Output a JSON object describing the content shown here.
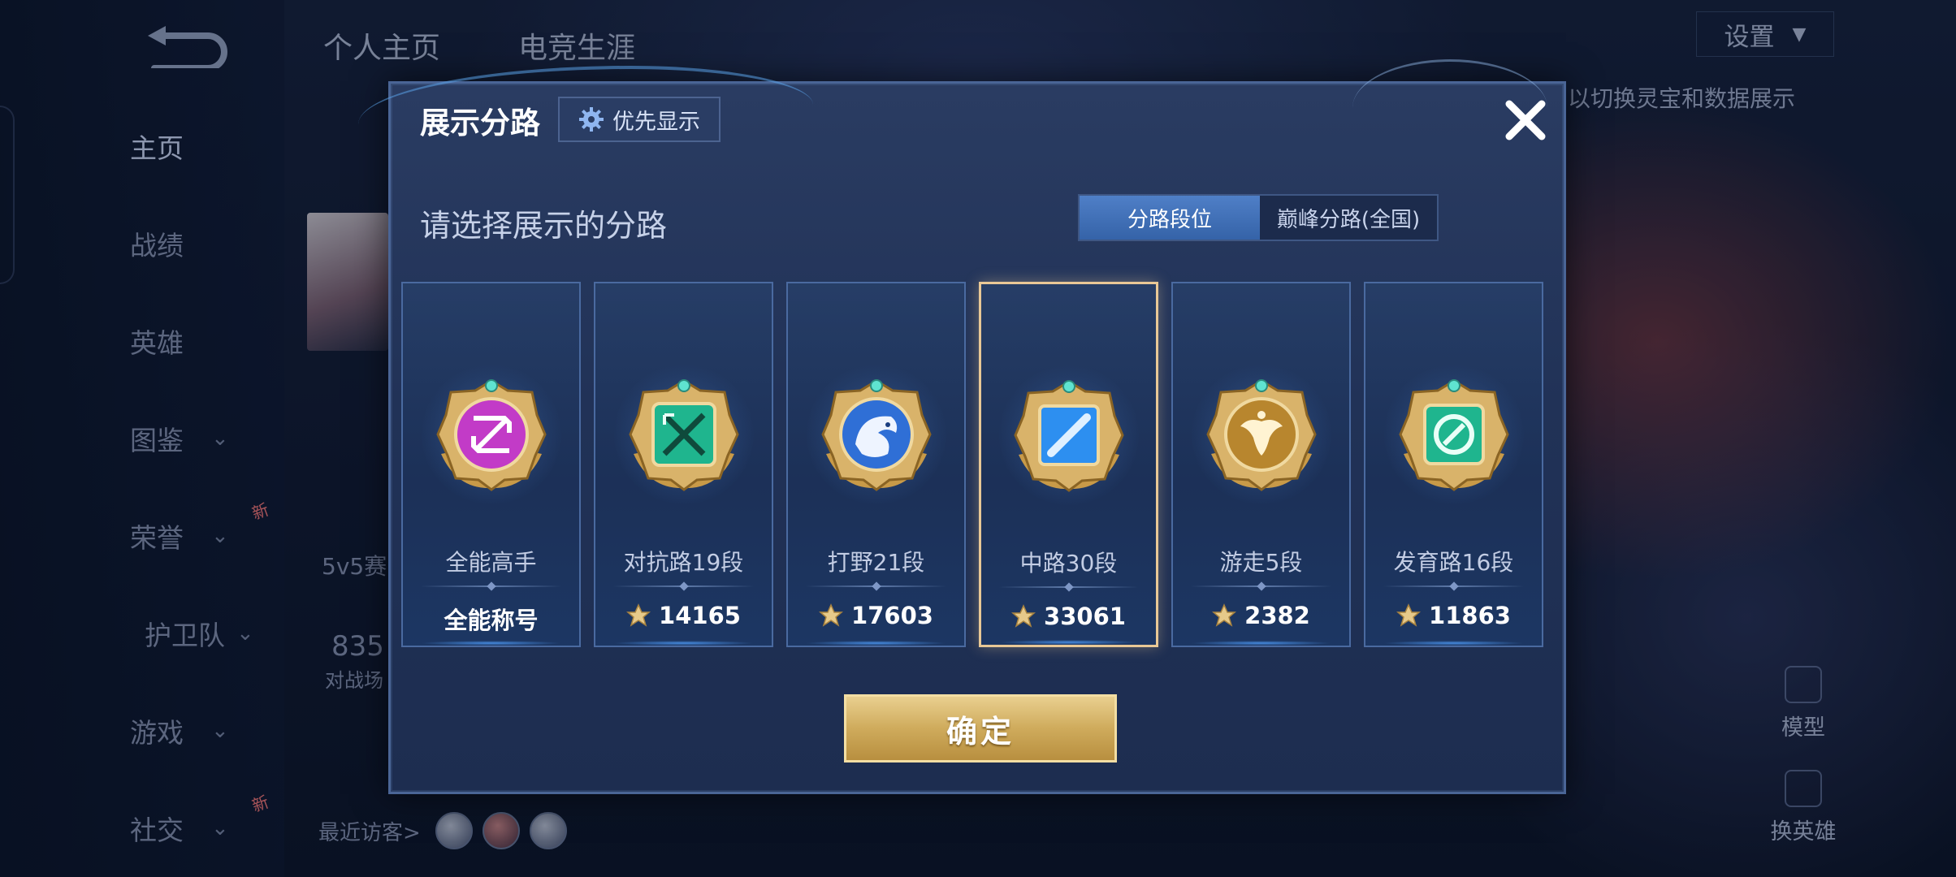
{
  "background": {
    "top_tabs": [
      "个人主页",
      "电竞生涯"
    ],
    "nav_items": [
      {
        "label": "主页",
        "active": true,
        "chevron": false,
        "badge": ""
      },
      {
        "label": "战绩",
        "active": false,
        "chevron": false,
        "badge": ""
      },
      {
        "label": "英雄",
        "active": false,
        "chevron": false,
        "badge": ""
      },
      {
        "label": "图鉴",
        "active": false,
        "chevron": true,
        "badge": ""
      },
      {
        "label": "荣誉",
        "active": false,
        "chevron": true,
        "badge": "新"
      },
      {
        "label": "护卫队",
        "active": false,
        "chevron": true,
        "badge": ""
      },
      {
        "label": "游戏",
        "active": false,
        "chevron": true,
        "badge": ""
      },
      {
        "label": "社交",
        "active": false,
        "chevron": true,
        "badge": "新"
      }
    ],
    "settings_label": "设置",
    "hint": "以切换灵宝和数据展示",
    "right_controls": [
      "模型",
      "换英雄"
    ],
    "recent_visitors": "最近访客>",
    "fragments": [
      "5v5赛",
      "835",
      "对战场"
    ]
  },
  "modal": {
    "title": "展示分路",
    "priority_button": "优先显示",
    "subtitle": "请选择展示的分路",
    "toggle": {
      "active": "分路段位",
      "inactive": "巅峰分路(全国)"
    },
    "cards": [
      {
        "name": "全能高手",
        "value": "全能称号",
        "show_icon": false,
        "emblem": "purple-emblem-icon",
        "color": "#c23bc7",
        "selected": false
      },
      {
        "name": "对抗路19段",
        "value": "14165",
        "show_icon": true,
        "emblem": "teal-sword-emblem-icon",
        "color": "#1fb58e",
        "selected": false
      },
      {
        "name": "打野21段",
        "value": "17603",
        "show_icon": true,
        "emblem": "dragon-emblem-icon",
        "color": "#2f6fd6",
        "selected": false
      },
      {
        "name": "中路30段",
        "value": "33061",
        "show_icon": true,
        "emblem": "mid-lane-emblem-icon",
        "color": "#2d8ff0",
        "selected": true
      },
      {
        "name": "游走5段",
        "value": "2382",
        "show_icon": true,
        "emblem": "roam-wings-emblem-icon",
        "color": "#b8862e",
        "selected": false
      },
      {
        "name": "发育路16段",
        "value": "11863",
        "show_icon": true,
        "emblem": "adc-emblem-icon",
        "color": "#1fb58e",
        "selected": false
      }
    ],
    "confirm": "确定"
  }
}
